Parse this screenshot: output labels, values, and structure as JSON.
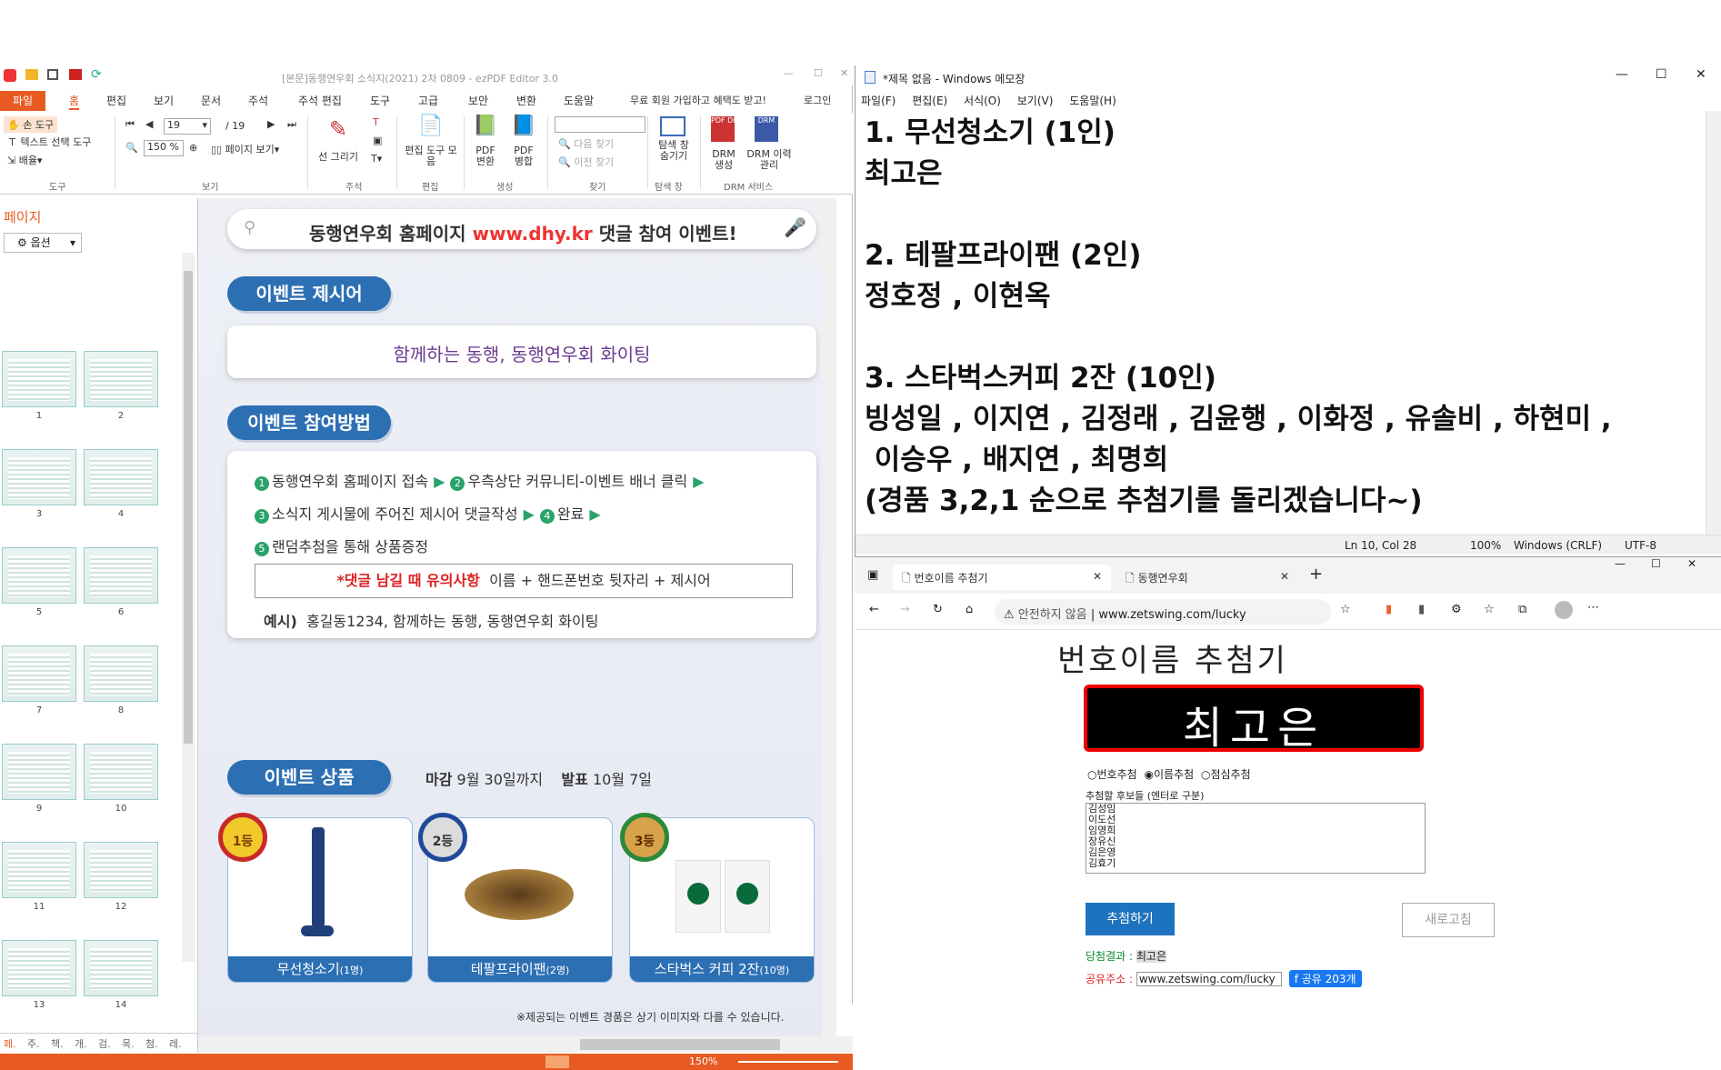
{
  "pdf_app": {
    "title": "[본문]동행연우회 소식지(2021) 2차 0809 - ezPDF Editor 3.0",
    "menus": [
      "파일",
      "홈",
      "편집",
      "보기",
      "문서",
      "주석",
      "주석 편집",
      "도구",
      "고급",
      "보안",
      "변환",
      "도움말"
    ],
    "promo": "무료 회원 가입하고 혜택도 받고!",
    "login": "로그인",
    "ribbon": {
      "hand_tool": "손 도구",
      "text_select": "텍스트 선택 도구",
      "arrange": "배율",
      "group_tool": "도구",
      "page_current": "19",
      "page_total": "/ 19",
      "zoom": "150 %",
      "page_view": "페이지 보기",
      "group_view": "보기",
      "line_draw": "선 그리기",
      "group_annot": "주석",
      "edit_tools": "편집 도구 모음",
      "group_edit": "편집",
      "pdf_convert": "PDF 변환",
      "pdf_merge": "PDF 병합",
      "group_create": "생성",
      "find_next": "다음 찾기",
      "find_prev": "이전 찾기",
      "group_find": "찾기",
      "explorer": "탐색 창 숨기기",
      "group_explorer": "탐색 창",
      "drm_create": "DRM 생성",
      "drm_history": "DRM 이력 관리",
      "group_drm": "DRM 서비스"
    },
    "sidebar": {
      "title": "페이지",
      "options": "옵션",
      "pages": [
        "1",
        "2",
        "3",
        "4",
        "5",
        "6",
        "7",
        "8",
        "9",
        "10",
        "11",
        "12",
        "13",
        "14"
      ],
      "bottom_tabs": [
        "페.",
        "주.",
        "책.",
        "개.",
        "검.",
        "목.",
        "첨.",
        "레."
      ]
    },
    "status_zoom": "150%"
  },
  "doc": {
    "search_banner_prefix": "동행연우회 홈페이지 ",
    "search_banner_url": "www.dhy.kr",
    "search_banner_suffix": " 댓글 참여 이벤트!",
    "section1": "이벤트 제시어",
    "slogan": "함께하는 동행, 동행연우회 화이팅",
    "section2": "이벤트 참여방법",
    "steps": {
      "s1": "동행연우회 홈페이지 접속",
      "s2": "우측상단 커뮤니티-이벤트 배너 클릭",
      "s3": "소식지 게시물에 주어진 제시어 댓글작성",
      "s4": "완료",
      "s5": "랜덤추첨을 통해 상품증정"
    },
    "notice_label": "*댓글 남길 때 유의사항",
    "notice_text": "이름 + 핸드폰번호 뒷자리 + 제시어",
    "example_label": "예시)",
    "example_text": "홍길동1234, 함께하는 동행, 동행연우회 화이팅",
    "section3": "이벤트 상품",
    "deadline_label": "마감",
    "deadline": "9월 30일까지",
    "announce_label": "발표",
    "announce": "10월 7일",
    "prizes": [
      {
        "rank": "1등",
        "name": "무선청소기",
        "count": "(1명)"
      },
      {
        "rank": "2등",
        "name": "테팔프라이팬",
        "count": "(2명)"
      },
      {
        "rank": "3등",
        "name": "스타벅스 커피 2잔",
        "count": "(10명)"
      }
    ],
    "footnote": "※제공되는 이벤트 경품은 상기 이미지와 다를 수 있습니다."
  },
  "notepad": {
    "title": "*제목 없음 - Windows 메모장",
    "menus": [
      "파일(F)",
      "편집(E)",
      "서식(O)",
      "보기(V)",
      "도움말(H)"
    ],
    "content": "1. 무선청소기 (1인)\n최고은\n\n2. 테팔프라이팬 (2인)\n정호정 , 이현옥\n\n3. 스타벅스커피 2잔 (10인)\n빙성일 , 이지연 , 김정래 , 김윤행 , 이화정 , 유솔비 , 하현미 ,\n 이승우 , 배지연 , 최명희\n(경품 3,2,1 순으로 추첨기를 돌리겠습니다~)",
    "status": {
      "pos": "Ln 10, Col 28",
      "zoom": "100%",
      "eol": "Windows (CRLF)",
      "enc": "UTF-8"
    }
  },
  "browser": {
    "tabs": [
      "번호이름 추첨기",
      "동행연우회"
    ],
    "security": "안전하지 않음",
    "url": "www.zetswing.com/lucky",
    "page": {
      "title": "번호이름 추첨기",
      "result_big": "최고은",
      "modes": [
        "번호추첨",
        "이름추첨",
        "점심추첨"
      ],
      "candidates_label": "추첨할 후보들 (엔터로 구분)",
      "candidates": "김성임\n이도선\n임영희\n장유신\n김은영\n김효기",
      "draw_button": "추첨하기",
      "reset_button": "새로고침",
      "result_label": "당첨결과 :",
      "result_value": "최고은",
      "share_label": "공유주소 :",
      "share_url": "www.zetswing.com/lucky",
      "fb_button": "공유 203개"
    }
  },
  "colors": {
    "accent_blue": "#2d6fb3",
    "ezpdf_orange": "#e75b22",
    "slogan_purple": "#6b3a8f",
    "green": "#2aa36b"
  }
}
